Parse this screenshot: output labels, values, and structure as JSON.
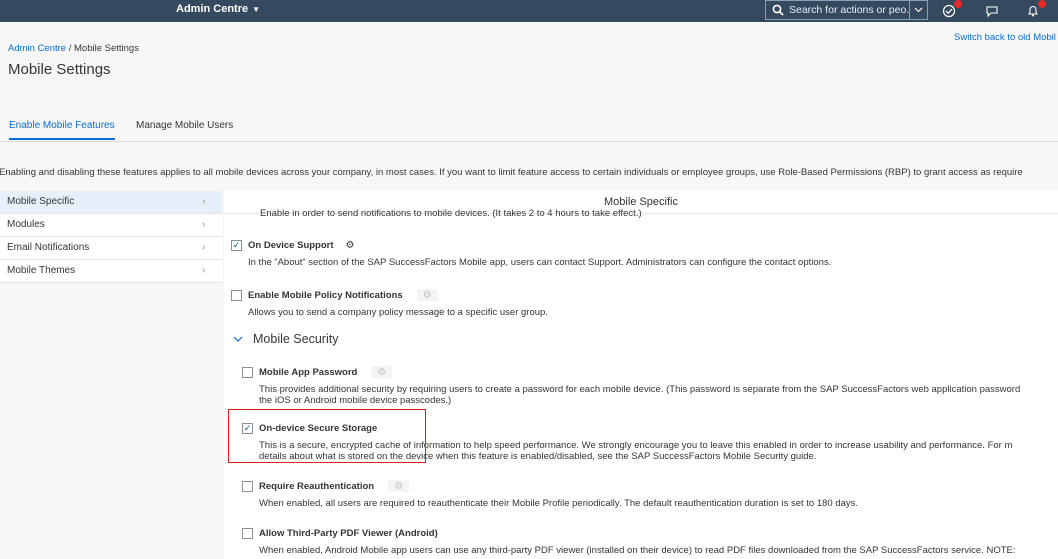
{
  "shell": {
    "title": "Admin Centre",
    "search_placeholder": "Search for actions or peo...",
    "colors": {
      "shell_bg": "#354a5f",
      "accent": "#0a6ed1",
      "badge": "#e52929"
    }
  },
  "header": {
    "breadcrumb_link": "Admin Centre",
    "breadcrumb_sep": " / ",
    "breadcrumb_current": "Mobile Settings",
    "page_title": "Mobile Settings",
    "switch_link": "Switch back to old Mobil"
  },
  "tabs": [
    {
      "label": "Enable Mobile Features"
    },
    {
      "label": "Manage Mobile Users"
    }
  ],
  "info_text": "Enabling and disabling these features applies to all mobile devices across your company, in most cases. If you want to limit feature access to certain individuals or employee groups, use Role-Based Permissions (RBP) to grant access as require",
  "nav": {
    "items": [
      {
        "label": "Mobile Specific"
      },
      {
        "label": "Modules"
      },
      {
        "label": "Email Notifications"
      },
      {
        "label": "Mobile Themes"
      }
    ]
  },
  "panel": {
    "title": "Mobile Specific",
    "cut_line": "Enable in order to send notifications to mobile devices. (It takes 2 to 4 hours to take effect.)",
    "section": "Mobile Security",
    "features": [
      {
        "title": "On Device Support",
        "checked": true,
        "desc": "In the “About” section of the SAP SuccessFactors Mobile app, users can contact Support. Administrators can configure the contact options."
      },
      {
        "title": "Enable Mobile Policy Notifications",
        "checked": false,
        "desc": "Allows you to send a company policy message to a specific user group."
      },
      {
        "title": "Mobile App Password",
        "checked": false,
        "desc1": "This provides additional security by requiring users to create a password for each mobile device. (This password is separate from the SAP SuccessFactors web application password",
        "desc2": "the iOS or Android mobile device passcodes.)"
      },
      {
        "title": "On-device Secure Storage",
        "checked": true,
        "desc1": "This is a secure, encrypted cache of information to help speed performance. We strongly encourage you to leave this enabled in order to increase usability and performance. For m",
        "desc2": "details about what is stored on the device when this feature is enabled/disabled, see the SAP SuccessFactors Mobile Security guide."
      },
      {
        "title": "Require Reauthentication",
        "checked": false,
        "desc": "When enabled, all users are required to reauthenticate their Mobile Profile periodically. The default reauthentication duration is set to 180 days."
      },
      {
        "title": "Allow Third-Party PDF Viewer (Android)",
        "checked": false,
        "desc": "When enabled, Android Mobile app users can use any third-party PDF viewer (installed on their device) to read PDF files downloaded from the SAP SuccessFactors service. NOTE:"
      }
    ]
  }
}
